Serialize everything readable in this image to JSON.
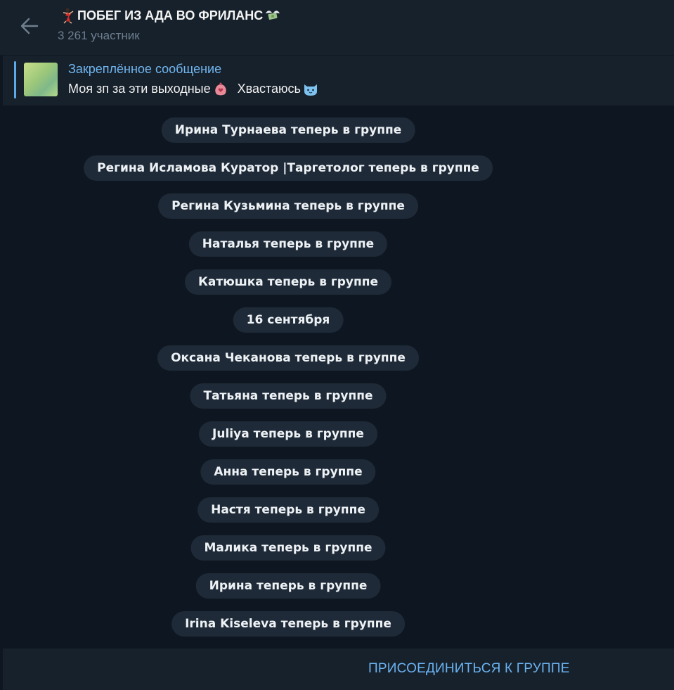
{
  "header": {
    "title": "ПОБЕГ ИЗ АДА ВО ФРИЛАНС",
    "title_prefix_icon": "dancer-emoji-icon",
    "title_suffix_icon": "money-wings-emoji-icon",
    "subtitle": "3 261 участник",
    "back_icon": "arrow-left-icon"
  },
  "pinned": {
    "title": "Закреплённое сообщение",
    "text_part1": "Моя зп за эти выходные",
    "icon1": "money-bag-heart-emoji-icon",
    "text_part2": "  Хвастаюсь",
    "icon2": "cat-face-emoji-icon"
  },
  "service_messages": [
    "Ирина Турнаева теперь в группе",
    "Регина Исламова Куратор |Таргетолог теперь в группе",
    "Регина Кузьмина теперь в группе",
    "Наталья теперь в группе",
    "Катюшка теперь в группе",
    "16 сентября",
    "Оксана Чеканова теперь в группе",
    "Татьяна теперь в группе",
    "Juliya теперь в группе",
    "Анна теперь в группе",
    "Настя теперь в группе",
    "Малика теперь в группе",
    "Ирина теперь в группе",
    "Irina Kiseleva теперь в группе"
  ],
  "bottom": {
    "join_label": "ПРИСОЕДИНИТЬСЯ К ГРУППЕ"
  },
  "colors": {
    "background": "#0e1621",
    "header": "#17212b",
    "accent": "#6ab3f3",
    "service_bubble": "#1e2a38"
  }
}
